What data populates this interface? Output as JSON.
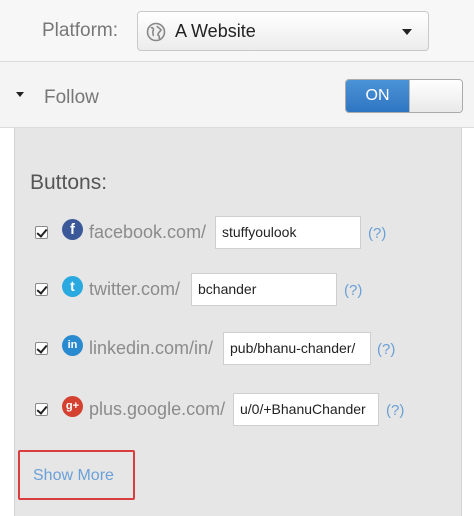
{
  "platform": {
    "label": "Platform:",
    "selected": "A Website"
  },
  "follow": {
    "label": "Follow",
    "toggle_label": "ON",
    "toggle_on": true
  },
  "buttons": {
    "heading": "Buttons:",
    "items": [
      {
        "network": "facebook",
        "icon": "facebook-icon",
        "icon_glyph": "f",
        "icon_color": "#3b5998",
        "domain": "facebook.com/",
        "value": "stuffyoulook",
        "help": "(?)",
        "checked": true
      },
      {
        "network": "twitter",
        "icon": "twitter-icon",
        "icon_glyph": "t",
        "icon_color": "#2aa9e0",
        "domain": "twitter.com/",
        "value": "bchander",
        "help": "(?)",
        "checked": true
      },
      {
        "network": "linkedin",
        "icon": "linkedin-icon",
        "icon_glyph": "in",
        "icon_color": "#2a8ad0",
        "domain": "linkedin.com/in/",
        "value": "pub/bhanu-chander/",
        "help": "(?)",
        "checked": true
      },
      {
        "network": "googleplus",
        "icon": "google-plus-icon",
        "icon_glyph": "g+",
        "icon_color": "#d44130",
        "domain": "plus.google.com/",
        "value": "u/0/+BhanuChander",
        "help": "(?)",
        "checked": true
      }
    ],
    "show_more": "Show More"
  }
}
